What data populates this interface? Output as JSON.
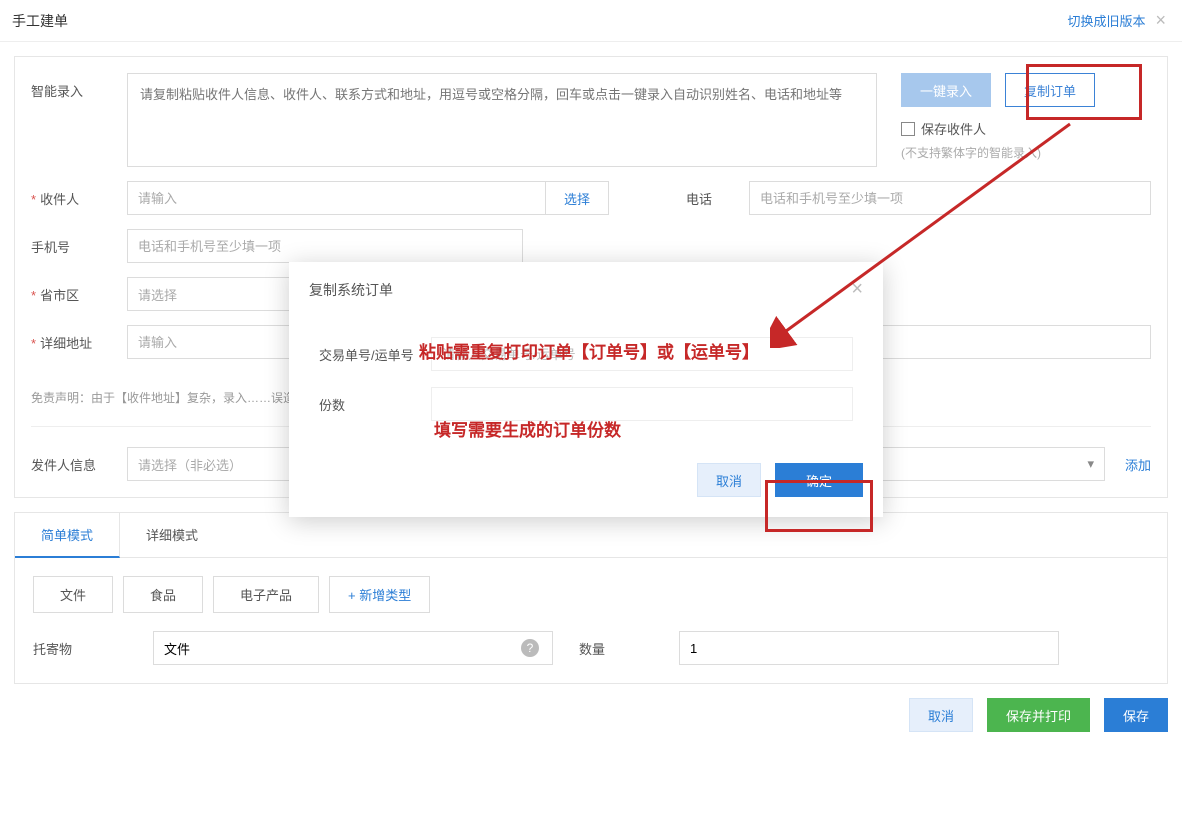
{
  "header": {
    "title": "手工建单",
    "switch_link": "切换成旧版本"
  },
  "smart": {
    "label": "智能录入",
    "placeholder": "请复制粘贴收件人信息、收件人、联系方式和地址，用逗号或空格分隔，回车或点击一键录入自动识别姓名、电话和地址等",
    "btn_onekey": "一键录入",
    "btn_copy": "复制订单",
    "save_recipient": "保存收件人",
    "hint": "(不支持繁体字的智能录入)"
  },
  "fields": {
    "recipient_label": "收件人",
    "recipient_placeholder": "请输入",
    "recipient_select": "选择",
    "phone_label": "电话",
    "phone_placeholder": "电话和手机号至少填一项",
    "mobile_label": "手机号",
    "mobile_placeholder": "电话和手机号至少填一项",
    "region_label": "省市区",
    "region_placeholder": "请选择",
    "address_label": "详细地址",
    "address_placeholder": "请输入"
  },
  "disclaimer": "免责声明：由于【收件地址】复杂，录入……误造成的损失。",
  "sender": {
    "label": "发件人信息",
    "placeholder": "请选择（非必选）",
    "add": "添加"
  },
  "tabs": {
    "simple": "简单模式",
    "detail": "详细模式"
  },
  "chips": {
    "file": "文件",
    "food": "食品",
    "elec": "电子产品",
    "add": "+ 新增类型"
  },
  "goods": {
    "label": "托寄物",
    "value": "文件",
    "qty_label": "数量",
    "qty_value": "1"
  },
  "footer": {
    "cancel": "取消",
    "save_print": "保存并打印",
    "save": "保存"
  },
  "modal": {
    "title": "复制系统订单",
    "field1_label": "交易单号/运单号",
    "field1_placeholder": "请输入交易单号/运单号",
    "field2_label": "份数",
    "cancel": "取消",
    "ok": "确定"
  },
  "anno": {
    "line1": "粘贴需重复打印订单【订单号】或【运单号】",
    "line2": "填写需要生成的订单份数"
  }
}
